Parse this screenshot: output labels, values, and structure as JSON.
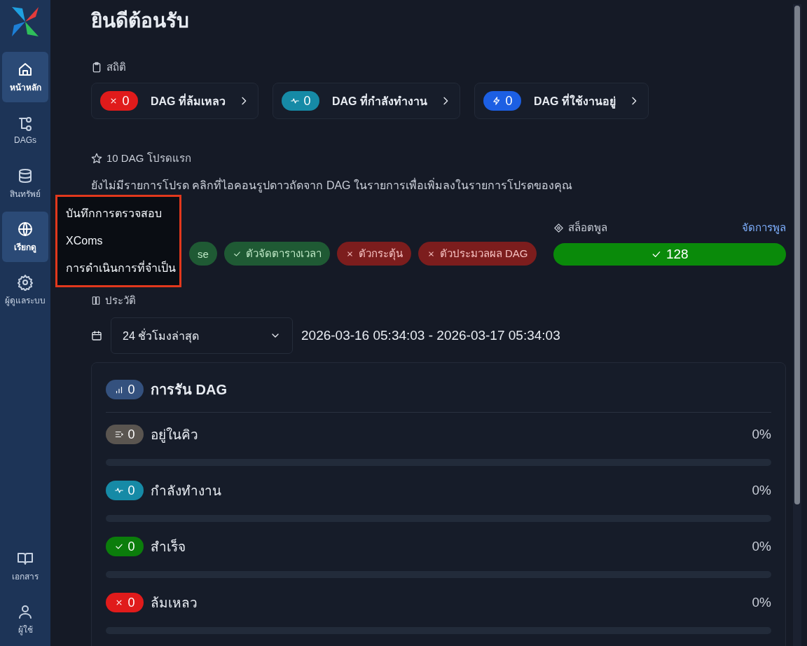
{
  "sidebar": {
    "items": [
      {
        "label": "หน้าหลัก",
        "selected": true
      },
      {
        "label": "DAGs",
        "selected": false
      },
      {
        "label": "สินทรัพย์",
        "selected": false
      },
      {
        "label": "เรียกดู",
        "selected": true
      },
      {
        "label": "ผู้ดูแลระบบ",
        "selected": false
      }
    ],
    "bottom_items": [
      {
        "label": "เอกสาร"
      },
      {
        "label": "ผู้ใช้"
      }
    ]
  },
  "menu": {
    "items": [
      "บันทึกการตรวจสอบ",
      "XComs",
      "การดำเนินการที่จำเป็น"
    ]
  },
  "title": "ยินดีต้อนรับ",
  "stats": {
    "heading": "สถิติ",
    "cards": [
      {
        "kind": "failed",
        "count": "0",
        "label": "DAG ที่ล้มเหลว",
        "color": "#e01b1b"
      },
      {
        "kind": "running",
        "count": "0",
        "label": "DAG ที่กำลังทำงาน",
        "color": "#168aa6"
      },
      {
        "kind": "active",
        "count": "0",
        "label": "DAG ที่ใช้งานอยู่",
        "color": "#1c5fe3"
      }
    ]
  },
  "favorites": {
    "heading": "10 DAG โปรดแรก",
    "message": "ยังไม่มีรายการโปรด คลิกที่ไอคอนรูปดาวถัดจาก DAG ในรายการเพื่อเพิ่มลงในรายการโปรดของคุณ"
  },
  "health": {
    "components": [
      {
        "label": "se",
        "healthy": true
      },
      {
        "label": "ตัวจัดตารางเวลา",
        "healthy": true
      },
      {
        "label": "ตัวกระตุ้น",
        "healthy": false
      },
      {
        "label": "ตัวประมวลผล DAG",
        "healthy": false
      }
    ]
  },
  "pool": {
    "heading": "สล็อตพูล",
    "link": "จัดการพูล",
    "value": "128"
  },
  "history": {
    "heading": "ประวัติ",
    "range": "24 ชั่วโมงล่าสุด",
    "span": "2026-03-16 05:34:03 - 2026-03-17 05:34:03"
  },
  "runs": {
    "count": "0",
    "title": "การรัน DAG",
    "rows": [
      {
        "kind": "queued",
        "count": "0",
        "label": "อยู่ในคิว",
        "percent": "0%",
        "level": 0,
        "color": "#5a5550"
      },
      {
        "kind": "running",
        "count": "0",
        "label": "กำลังทำงาน",
        "percent": "0%",
        "level": 0,
        "color": "#168aa6"
      },
      {
        "kind": "success",
        "count": "0",
        "label": "สำเร็จ",
        "percent": "0%",
        "level": 0,
        "color": "#0b7d0b"
      },
      {
        "kind": "failed",
        "count": "0",
        "label": "ล้มเหลว",
        "percent": "0%",
        "level": 0,
        "color": "#e01b1b"
      }
    ]
  }
}
